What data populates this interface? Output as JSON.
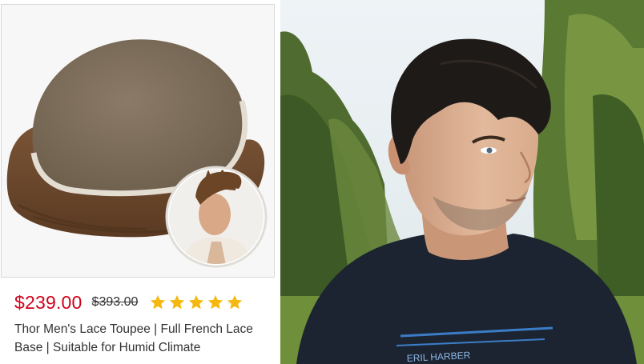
{
  "product": {
    "price": "$239.00",
    "old_price": "$393.00",
    "rating": 5,
    "rating_max": 5,
    "star_color": "#f5b80f",
    "price_color": "#d0021b",
    "title": "Thor Men's Lace Toupee | Full French Lace Base | Suitable for Humid Climate",
    "image_icon": "lace-toupee-hairpiece",
    "model_icon": "male-model-avatar"
  },
  "photo": {
    "shirt_text": "ERIL HARBER"
  }
}
